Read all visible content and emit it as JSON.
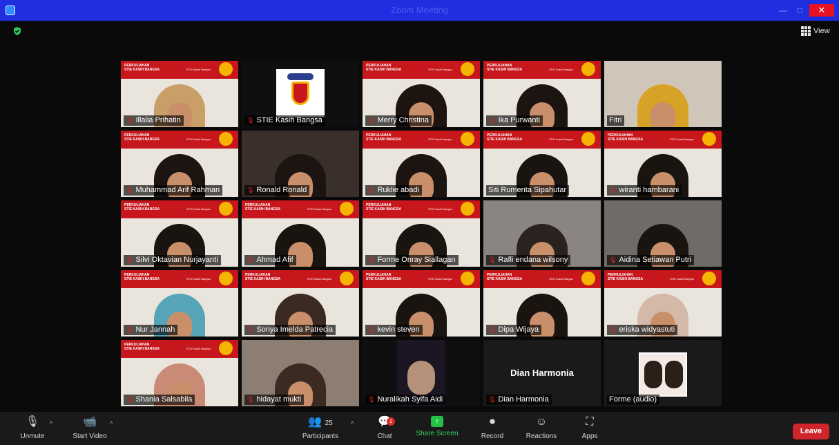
{
  "window": {
    "title": "Zoom Meeting",
    "minimize_label": "—",
    "maximize_label": "□",
    "close_label": "✕"
  },
  "header": {
    "view_label": "View",
    "security_icon": "shield-check-icon"
  },
  "participants": [
    {
      "name": "Illalia Prihatin",
      "muted": true,
      "banner": true
    },
    {
      "name": "STIE Kasih Bangsa",
      "muted": true,
      "banner": false,
      "logo": true
    },
    {
      "name": "Merry Christina",
      "muted": true,
      "banner": true
    },
    {
      "name": "Ika Purwanti",
      "muted": true,
      "banner": true
    },
    {
      "name": "Fitri",
      "muted": false,
      "banner": false
    },
    {
      "name": "Muhammad Arif Rahman",
      "muted": true,
      "banner": true
    },
    {
      "name": "Ronald Ronald",
      "muted": true,
      "banner": false
    },
    {
      "name": "Ruklie abadi",
      "muted": true,
      "banner": true
    },
    {
      "name": "Siti Rumenta Sipahutar",
      "muted": false,
      "banner": true,
      "active": true
    },
    {
      "name": "wiranti hambarani",
      "muted": true,
      "banner": true
    },
    {
      "name": "Silvi Oktavian Nurjayanti",
      "muted": true,
      "banner": true
    },
    {
      "name": "Ahmad Afif",
      "muted": true,
      "banner": true
    },
    {
      "name": "Forme Onray Siallagan",
      "muted": true,
      "banner": true
    },
    {
      "name": "Rafli endana wilsony",
      "muted": true,
      "banner": false
    },
    {
      "name": "Aidina Setiawan Putri",
      "muted": true,
      "banner": false
    },
    {
      "name": "Nur Jannah",
      "muted": true,
      "banner": true
    },
    {
      "name": "Sonya Imelda Patrecia",
      "muted": true,
      "banner": true
    },
    {
      "name": "kevin steven",
      "muted": true,
      "banner": true
    },
    {
      "name": "Dipa Wijaya",
      "muted": true,
      "banner": true
    },
    {
      "name": "eriska widyastuti",
      "muted": true,
      "banner": true
    },
    {
      "name": "Shania Salsabila",
      "muted": true,
      "banner": true
    },
    {
      "name": "hidayat mukti",
      "muted": true,
      "banner": false
    },
    {
      "name": "Nuralikah Syifa Aidi",
      "muted": true,
      "banner": false
    },
    {
      "name": "Dian Harmonia",
      "muted": true,
      "banner": false,
      "center_name": "Dian Harmonia"
    },
    {
      "name": "Forme (audio)",
      "muted": false,
      "banner": false
    }
  ],
  "banner": {
    "line1": "PERKULIAHAN",
    "line2": "STIE KASIH BANGSA",
    "small": "STIE Kasih Bangsa"
  },
  "toolbar": {
    "unmute": "Unmute",
    "start_video": "Start Video",
    "participants": "Participants",
    "participants_count": "25",
    "chat": "Chat",
    "chat_badge": "1",
    "share_screen": "Share Screen",
    "record": "Record",
    "reactions": "Reactions",
    "apps": "Apps",
    "leave": "Leave"
  },
  "colors": {
    "title_bar": "#1f2ee0",
    "banner_red": "#c7171c",
    "share_green": "#23c144",
    "leave_red": "#d0262b",
    "active_outline": "#e6e85f"
  }
}
